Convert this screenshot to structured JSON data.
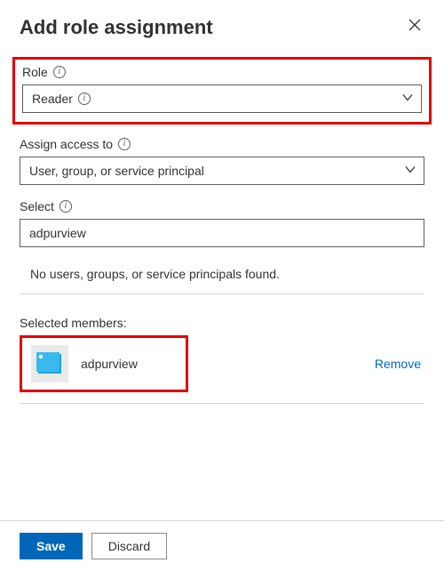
{
  "header": {
    "title": "Add role assignment"
  },
  "role": {
    "label": "Role",
    "selected": "Reader"
  },
  "assign": {
    "label": "Assign access to",
    "selected": "User, group, or service principal"
  },
  "select": {
    "label": "Select",
    "value": "adpurview"
  },
  "results": {
    "empty_message": "No users, groups, or service principals found."
  },
  "selected_members": {
    "label": "Selected members:",
    "items": [
      {
        "name": "adpurview"
      }
    ],
    "remove_label": "Remove"
  },
  "footer": {
    "save_label": "Save",
    "discard_label": "Discard"
  }
}
